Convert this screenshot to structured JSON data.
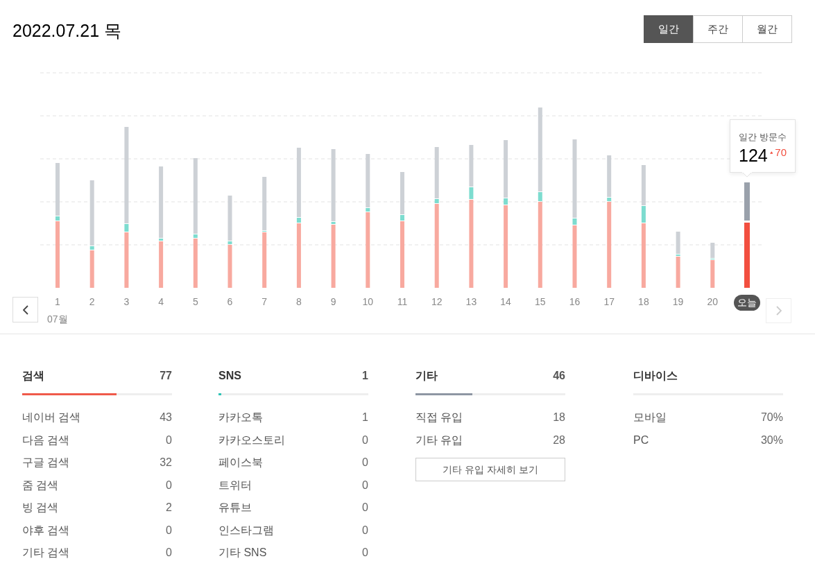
{
  "header": {
    "date": "2022.07.21 목"
  },
  "tabs": [
    {
      "label": "일간",
      "selected": true
    },
    {
      "label": "주간",
      "selected": false
    },
    {
      "label": "월간",
      "selected": false
    }
  ],
  "chart": {
    "days": [
      "1",
      "2",
      "3",
      "4",
      "5",
      "6",
      "7",
      "8",
      "9",
      "10",
      "11",
      "12",
      "13",
      "14",
      "15",
      "16",
      "17",
      "18",
      "19",
      "20"
    ],
    "month": "07월",
    "today": "오늘",
    "tooltip": {
      "label": "일간 방문수",
      "value": "124",
      "change": "70"
    },
    "prev_disabled": false,
    "next_disabled": true
  },
  "sections": [
    {
      "title": "검색",
      "total": "77",
      "level": 0.63,
      "color": "#ef5a4a",
      "rows": [
        {
          "label": "네이버 검색",
          "value": "43"
        },
        {
          "label": "다음 검색",
          "value": "0"
        },
        {
          "label": "구글 검색",
          "value": "32"
        },
        {
          "label": "줌 검색",
          "value": "0"
        },
        {
          "label": "빙 검색",
          "value": "2"
        },
        {
          "label": "야후 검색",
          "value": "0"
        },
        {
          "label": "기타 검색",
          "value": "0"
        }
      ]
    },
    {
      "title": "SNS",
      "total": "1",
      "level": 0.02,
      "color": "#2ec4b6",
      "rows": [
        {
          "label": "카카오톡",
          "value": "1"
        },
        {
          "label": "카카오스토리",
          "value": "0"
        },
        {
          "label": "페이스북",
          "value": "0"
        },
        {
          "label": "트위터",
          "value": "0"
        },
        {
          "label": "유튜브",
          "value": "0"
        },
        {
          "label": "인스타그램",
          "value": "0"
        },
        {
          "label": "기타 SNS",
          "value": "0"
        }
      ]
    },
    {
      "title": "기타",
      "total": "46",
      "level": 0.38,
      "color": "#8e96a3",
      "rows": [
        {
          "label": "직접 유입",
          "value": "18"
        },
        {
          "label": "기타 유입",
          "value": "28"
        }
      ],
      "button": "기타 유입 자세히 보기"
    },
    {
      "title": "디바이스",
      "rows": [
        {
          "label": "모바일",
          "value": "70%"
        },
        {
          "label": "PC",
          "value": "30%"
        }
      ]
    }
  ]
}
